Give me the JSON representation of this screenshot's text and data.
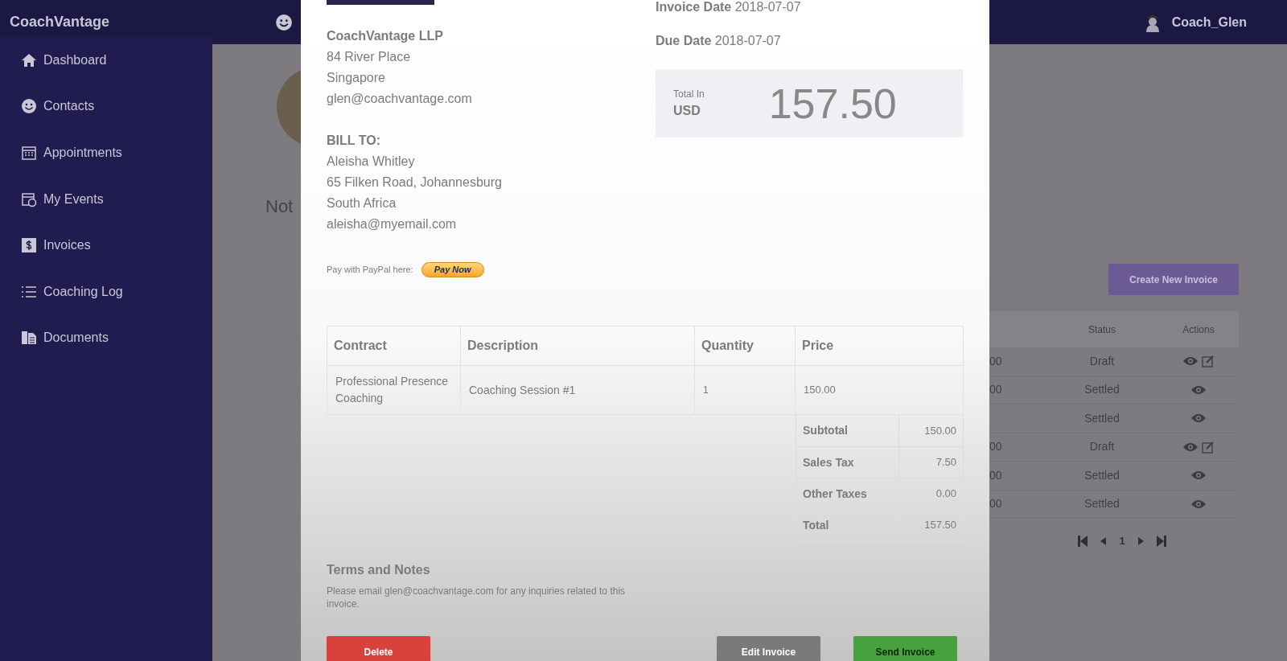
{
  "topbar": {
    "brand": "CoachVantage",
    "user": "Coach_Glen"
  },
  "sidebar": {
    "items": [
      {
        "label": "Dashboard"
      },
      {
        "label": "Contacts"
      },
      {
        "label": "Appointments"
      },
      {
        "label": "My Events"
      },
      {
        "label": "Invoices"
      },
      {
        "label": "Coaching Log"
      },
      {
        "label": "Documents"
      }
    ]
  },
  "background": {
    "heading_fragment": "Not",
    "create_button": "Create New Invoice",
    "table": {
      "columns": [
        "Status",
        "Actions"
      ],
      "rows": [
        {
          "column_1": "00",
          "status": "Draft",
          "editable": true
        },
        {
          "column_1": "00",
          "status": "Settled",
          "editable": false
        },
        {
          "status": "Settled",
          "editable": false
        },
        {
          "column_1": "00",
          "status": "Draft",
          "editable": true
        },
        {
          "column_1": "00",
          "status": "Settled",
          "editable": false
        },
        {
          "column_1": "00",
          "status": "Settled",
          "editable": false
        }
      ]
    },
    "pagination": {
      "page": "1"
    }
  },
  "invoice": {
    "sender": [
      "CoachVantage LLP",
      "84 River Place",
      "Singapore",
      "glen@coachvantage.com"
    ],
    "bill_to_heading": "BILL TO:",
    "bill_to": [
      "Aleisha Whitley",
      "65 Filken Road, Johannesburg",
      "South Africa",
      "aleisha@myemail.com"
    ],
    "paypal_label": "Pay with PayPal here:",
    "paypal_button": "Pay Now",
    "invoice_date": {
      "label": "Invoice Date",
      "value": "2018-07-07"
    },
    "due_date": {
      "label": "Due Date",
      "value": "2018-07-07"
    },
    "total_label": "Total In",
    "currency": "USD",
    "total": "157.50",
    "columns": [
      "Contract",
      "Description",
      "Quantity",
      "Price"
    ],
    "rows": [
      {
        "contract": "Professional Presence Coaching",
        "description": "Coaching Session #1",
        "quantity": "1",
        "price": "150.00"
      }
    ],
    "totals": [
      {
        "label": "Subtotal",
        "value": "150.00"
      },
      {
        "label": "Sales Tax",
        "value": "7.50"
      },
      {
        "label": "Other Taxes",
        "value": "0.00"
      },
      {
        "label": "Total",
        "value": "157.50"
      }
    ],
    "terms_heading": "Terms and Notes",
    "terms": "Please email glen@coachvantage.com for any inquiries related to this invoice.",
    "buttons": [
      {
        "label": "Delete",
        "kind": "danger"
      },
      {
        "label": "Edit Invoice",
        "kind": "secondary"
      },
      {
        "label": "Send Invoice",
        "kind": "success"
      }
    ]
  }
}
